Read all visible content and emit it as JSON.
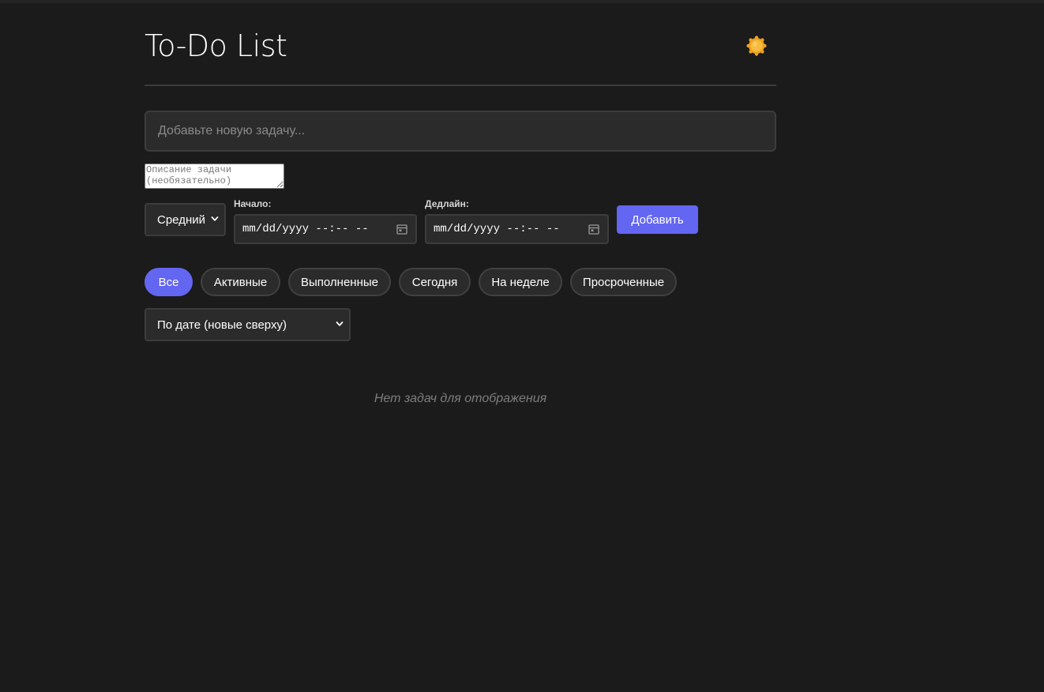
{
  "header": {
    "title": "To-Do List",
    "theme_icon": "sun-icon"
  },
  "form": {
    "task_placeholder": "Добавьте новую задачу...",
    "description_placeholder": "Описание задачи (необязательно)",
    "priority_value": "Средний",
    "start_label": "Начало:",
    "start_placeholder": "mm/dd/yyyy --:-- --",
    "deadline_label": "Дедлайн:",
    "deadline_placeholder": "mm/dd/yyyy --:-- --",
    "add_label": "Добавить"
  },
  "filters": [
    {
      "label": "Все",
      "active": true
    },
    {
      "label": "Активные",
      "active": false
    },
    {
      "label": "Выполненные",
      "active": false
    },
    {
      "label": "Сегодня",
      "active": false
    },
    {
      "label": "На неделе",
      "active": false
    },
    {
      "label": "Просроченные",
      "active": false
    }
  ],
  "sort": {
    "value": "По дате (новые сверху)"
  },
  "empty_message": "Нет задач для отображения",
  "colors": {
    "background": "#1b1b1b",
    "accent": "#6366f1",
    "surface": "#2b2b2b",
    "sun": "#f5a623"
  }
}
